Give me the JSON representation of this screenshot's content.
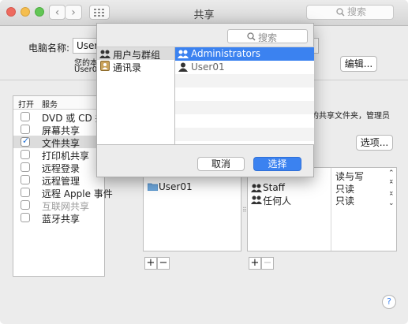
{
  "window": {
    "title": "共享",
    "search_placeholder": "搜索"
  },
  "computer_name": {
    "label": "电脑名称:",
    "value": "User",
    "info_line1": "您的本",
    "info_line2": "User0",
    "edit_button": "编辑..."
  },
  "services": {
    "header_on": "打开",
    "header_service": "服务",
    "items": [
      {
        "label": "DVD 或 CD 共享",
        "checked": false,
        "dimmed": false
      },
      {
        "label": "屏幕共享",
        "checked": false,
        "dimmed": false
      },
      {
        "label": "文件共享",
        "checked": true,
        "dimmed": false
      },
      {
        "label": "打印机共享",
        "checked": false,
        "dimmed": false
      },
      {
        "label": "远程登录",
        "checked": false,
        "dimmed": false
      },
      {
        "label": "远程管理",
        "checked": false,
        "dimmed": false
      },
      {
        "label": "远程 Apple 事件",
        "checked": false,
        "dimmed": false
      },
      {
        "label": "互联网共享",
        "checked": false,
        "dimmed": true
      },
      {
        "label": "蓝牙共享",
        "checked": false,
        "dimmed": false
      }
    ]
  },
  "file_sharing": {
    "desc_line1": "上的共享文件夹，管理员",
    "desc_line2": "",
    "options_button": "选项...",
    "shared_folders": [
      "User01"
    ],
    "users": [
      {
        "name": "Staff",
        "permission": "只读"
      },
      {
        "name": "任何人",
        "permission": "只读"
      }
    ],
    "first_permission": "读与写"
  },
  "controls": {
    "add": "+",
    "remove": "−"
  },
  "help": "?",
  "dialog": {
    "search_placeholder": "搜索",
    "sources": [
      {
        "label": "用户与群组",
        "selected": true,
        "icon": "group-icon"
      },
      {
        "label": "通讯录",
        "selected": false,
        "icon": "contacts-book-icon"
      }
    ],
    "members": [
      {
        "label": "Administrators",
        "selected": true,
        "icon": "group-icon"
      },
      {
        "label": "User01",
        "selected": false,
        "icon": "user-icon"
      }
    ],
    "cancel_button": "取消",
    "select_button": "选择",
    "accent": "#3b82f0"
  }
}
